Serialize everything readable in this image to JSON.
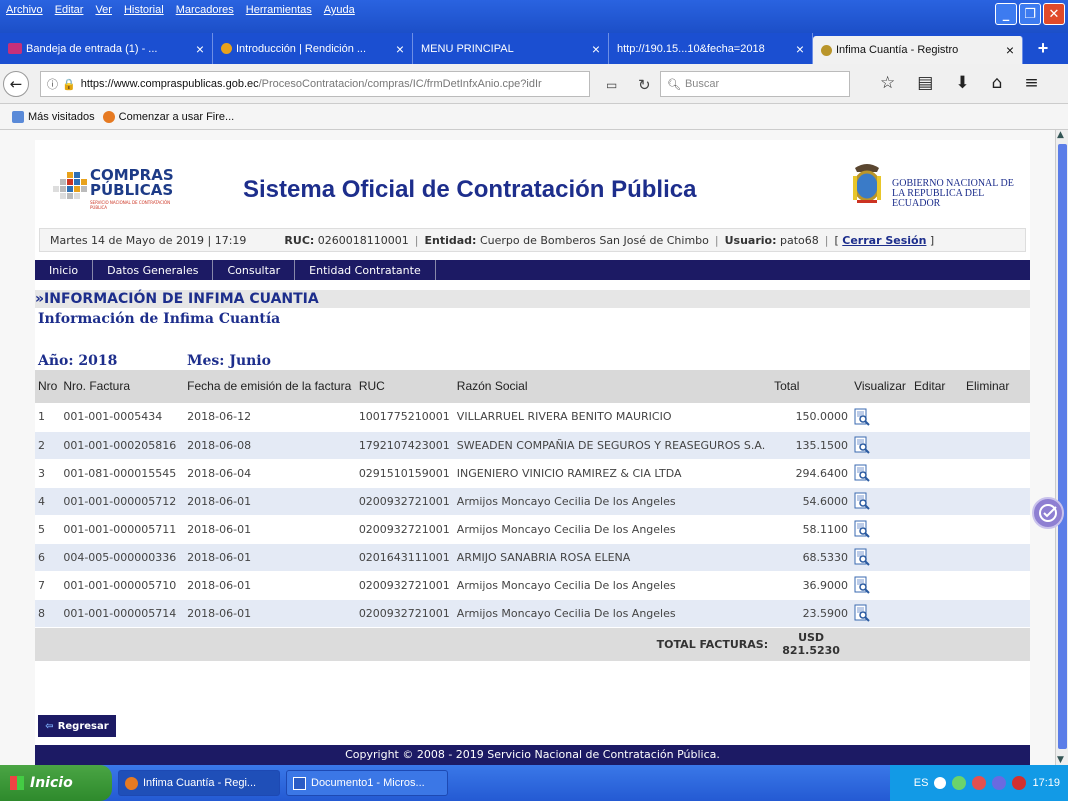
{
  "menubar": {
    "items": [
      "Archivo",
      "Editar",
      "Ver",
      "Historial",
      "Marcadores",
      "Herramientas",
      "Ayuda"
    ]
  },
  "tabs": [
    {
      "label": "Bandeja de entrada (1) - ...",
      "icon": "mail-icon"
    },
    {
      "label": "Introducción | Rendición ...",
      "icon": "info-icon"
    },
    {
      "label": "MENU PRINCIPAL",
      "icon": ""
    },
    {
      "label": "http://190.15...10&fecha=2018",
      "icon": ""
    },
    {
      "label": "Infima Cuantía - Registro",
      "icon": "shield-icon"
    }
  ],
  "navbar": {
    "url_host": "https://www.compraspublicas.gob.ec",
    "url_path": "/ProcesoContratacion/compras/IC/frmDetInfxAnio.cpe?idIr",
    "search_placeholder": "Buscar"
  },
  "bookmarks": [
    {
      "label": "Más visitados"
    },
    {
      "label": "Comenzar a usar Fire..."
    }
  ],
  "header": {
    "logo_line1": "COMPRAS",
    "logo_line2": "PÚBLICAS",
    "logo_sub": "SERVICIO NACIONAL DE CONTRATACIÓN PÚBLICA",
    "system_name": "Sistema Oficial de Contratación Pública",
    "gov_line1": "GOBIERNO NACIONAL DE",
    "gov_line2": "LA REPUBLICA DEL ECUADOR"
  },
  "infobar": {
    "date": "Martes 14 de Mayo de 2019 | 17:19",
    "ruc_label": "RUC:",
    "ruc": "0260018110001",
    "entity_label": "Entidad:",
    "entity": "Cuerpo de Bomberos San José de Chimbo",
    "user_label": "Usuario:",
    "user": "pato68",
    "logout": "Cerrar Sesión",
    "open_bracket": "[",
    "close_bracket": "]",
    "sep": "|"
  },
  "topnav": [
    "Inicio",
    "Datos Generales",
    "Consultar",
    "Entidad Contratante"
  ],
  "section_title": "»INFORMACIÓN DE INFIMA CUANTIA",
  "subtitle": "Información de Infima Cuantía",
  "year": "Año: 2018",
  "month": "Mes: Junio",
  "table": {
    "headers": [
      "Nro",
      "Nro. Factura",
      "Fecha de emisión de la factura",
      "RUC",
      "Razón Social",
      "Total",
      "Visualizar",
      "Editar",
      "Eliminar"
    ],
    "rows": [
      {
        "nro": "1",
        "factura": "001-001-0005434",
        "fecha": "2018-06-12",
        "ruc": "1001775210001",
        "razon": "VILLARRUEL RIVERA BENITO MAURICIO",
        "total": "150.0000"
      },
      {
        "nro": "2",
        "factura": "001-001-000205816",
        "fecha": "2018-06-08",
        "ruc": "1792107423001",
        "razon": "SWEADEN COMPAÑIA DE SEGUROS Y REASEGUROS S.A.",
        "total": "135.1500"
      },
      {
        "nro": "3",
        "factura": "001-081-000015545",
        "fecha": "2018-06-04",
        "ruc": "0291510159001",
        "razon": "INGENIERO VINICIO RAMIREZ & CIA LTDA",
        "total": "294.6400"
      },
      {
        "nro": "4",
        "factura": "001-001-000005712",
        "fecha": "2018-06-01",
        "ruc": "0200932721001",
        "razon": "Armijos Moncayo Cecilia De los Angeles",
        "total": "54.6000"
      },
      {
        "nro": "5",
        "factura": "001-001-000005711",
        "fecha": "2018-06-01",
        "ruc": "0200932721001",
        "razon": "Armijos Moncayo Cecilia De los Angeles",
        "total": "58.1100"
      },
      {
        "nro": "6",
        "factura": "004-005-000000336",
        "fecha": "2018-06-01",
        "ruc": "0201643111001",
        "razon": "ARMIJO SANABRIA ROSA ELENA",
        "total": "68.5330"
      },
      {
        "nro": "7",
        "factura": "001-001-000005710",
        "fecha": "2018-06-01",
        "ruc": "0200932721001",
        "razon": "Armijos Moncayo Cecilia De los Angeles",
        "total": "36.9000"
      },
      {
        "nro": "8",
        "factura": "001-001-000005714",
        "fecha": "2018-06-01",
        "ruc": "0200932721001",
        "razon": "Armijos Moncayo Cecilia De los Angeles",
        "total": "23.5900"
      }
    ],
    "total_label": "TOTAL FACTURAS:",
    "total_currency": "USD",
    "total_value": "821.5230"
  },
  "back_button": "Regresar",
  "footer": "Copyright © 2008 - 2019 Servicio Nacional de Contratación Pública.",
  "taskbar": {
    "start": "Inicio",
    "items": [
      "Infima Cuantía - Regi...",
      "Documento1 - Micros..."
    ],
    "lang": "ES",
    "clock": "17:19"
  },
  "colors": {
    "navy": "#1c1a64",
    "title_blue": "#1d2e8c",
    "row_alt": "#e4eaf5"
  }
}
